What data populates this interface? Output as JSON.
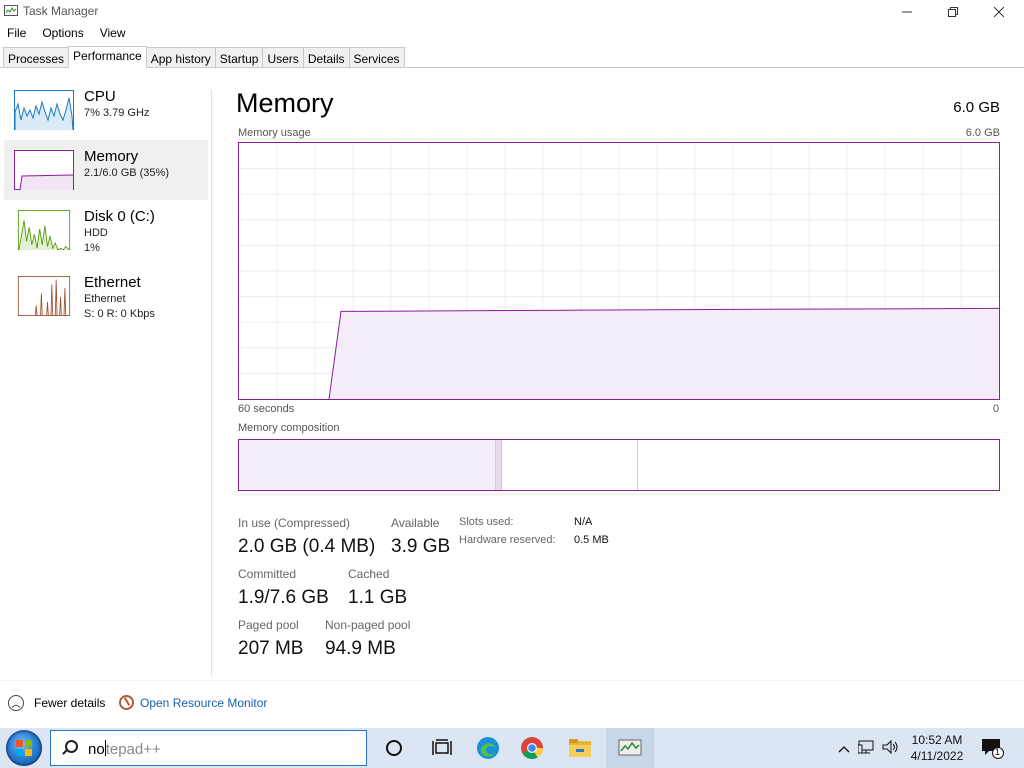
{
  "window": {
    "title": "Task Manager",
    "min_label": "—",
    "max_label": "❐",
    "close_label": "✕"
  },
  "menu": [
    "File",
    "Options",
    "View"
  ],
  "tabs": [
    "Processes",
    "Performance",
    "App history",
    "Startup",
    "Users",
    "Details",
    "Services"
  ],
  "active_tab": "Performance",
  "sidebar": [
    {
      "title": "CPU",
      "line1": "7% 3.79 GHz",
      "line2": "",
      "color": "#1779c5"
    },
    {
      "title": "Memory",
      "line1": "2.1/6.0 GB (35%)",
      "line2": "",
      "color": "#8b1e9b"
    },
    {
      "title": "Disk 0 (C:)",
      "line1": "HDD",
      "line2": "1%",
      "color": "#4e9a06"
    },
    {
      "title": "Ethernet",
      "line1": "Ethernet",
      "line2": "S: 0 R: 0 Kbps",
      "color": "#a0522d"
    }
  ],
  "memory": {
    "title": "Memory",
    "total": "6.0 GB",
    "usage_label": "Memory usage",
    "usage_max": "6.0 GB",
    "axis_left": "60 seconds",
    "axis_right": "0",
    "composition_label": "Memory composition",
    "stats": {
      "in_use_label": "In use (Compressed)",
      "in_use_value": "2.0 GB (0.4 MB)",
      "available_label": "Available",
      "available_value": "3.9 GB",
      "committed_label": "Committed",
      "committed_value": "1.9/7.6 GB",
      "cached_label": "Cached",
      "cached_value": "1.1 GB",
      "paged_label": "Paged pool",
      "paged_value": "207 MB",
      "nonpaged_label": "Non-paged pool",
      "nonpaged_value": "94.9 MB",
      "slots_label": "Slots used:",
      "slots_value": "N/A",
      "hw_label": "Hardware reserved:",
      "hw_value": "0.5 MB"
    },
    "usage_fraction": 0.35,
    "accent_color": "#8b1e9b"
  },
  "bottom": {
    "fewer_details": "Fewer details",
    "open_resource_monitor": "Open Resource Monitor"
  },
  "taskbar": {
    "search_typed": "no",
    "search_placeholder": "tepad++",
    "time": "10:52 AM",
    "date": "4/11/2022",
    "notification_count": "1",
    "icons": [
      "cortana-icon",
      "task-view-icon",
      "edge-icon",
      "chrome-icon",
      "file-explorer-icon",
      "task-manager-icon"
    ]
  }
}
